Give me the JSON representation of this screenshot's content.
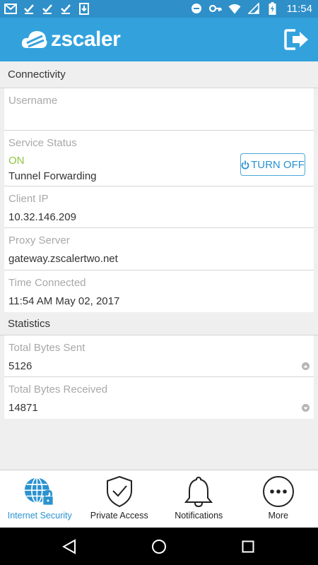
{
  "status_bar": {
    "time": "11:54",
    "left_icons": [
      "gmail-icon",
      "check-icon",
      "check-icon",
      "check-icon",
      "download-icon"
    ],
    "right_icons": [
      "do-not-disturb-icon",
      "key-icon",
      "wifi-icon",
      "signal-icon",
      "battery-charging-icon"
    ]
  },
  "app_bar": {
    "logo_text": "zscaler",
    "logout_icon": "logout-icon"
  },
  "connectivity": {
    "header": "Connectivity",
    "username_label": "Username",
    "username_value": "",
    "service_status_label": "Service Status",
    "service_status_value": "ON",
    "service_mode": "Tunnel Forwarding",
    "turn_off_label": "TURN OFF",
    "client_ip_label": "Client IP",
    "client_ip_value": "10.32.146.209",
    "proxy_label": "Proxy Server",
    "proxy_value": "gateway.zscalertwo.net",
    "time_connected_label": "Time Connected",
    "time_connected_value": "11:54 AM May 02, 2017"
  },
  "statistics": {
    "header": "Statistics",
    "bytes_sent_label": "Total Bytes Sent",
    "bytes_sent_value": "5126",
    "bytes_received_label": "Total Bytes Received",
    "bytes_received_value": "14871"
  },
  "bottom_nav": {
    "items": [
      {
        "label": "Internet Security",
        "icon": "globe-lock-icon",
        "active": true
      },
      {
        "label": "Private Access",
        "icon": "shield-check-icon",
        "active": false
      },
      {
        "label": "Notifications",
        "icon": "bell-icon",
        "active": false
      },
      {
        "label": "More",
        "icon": "more-dots-icon",
        "active": false
      }
    ]
  },
  "colors": {
    "status_bar": "#2e8fc9",
    "app_bar": "#33a2dc",
    "accent": "#2a92cf",
    "on_status": "#8cc63e"
  }
}
